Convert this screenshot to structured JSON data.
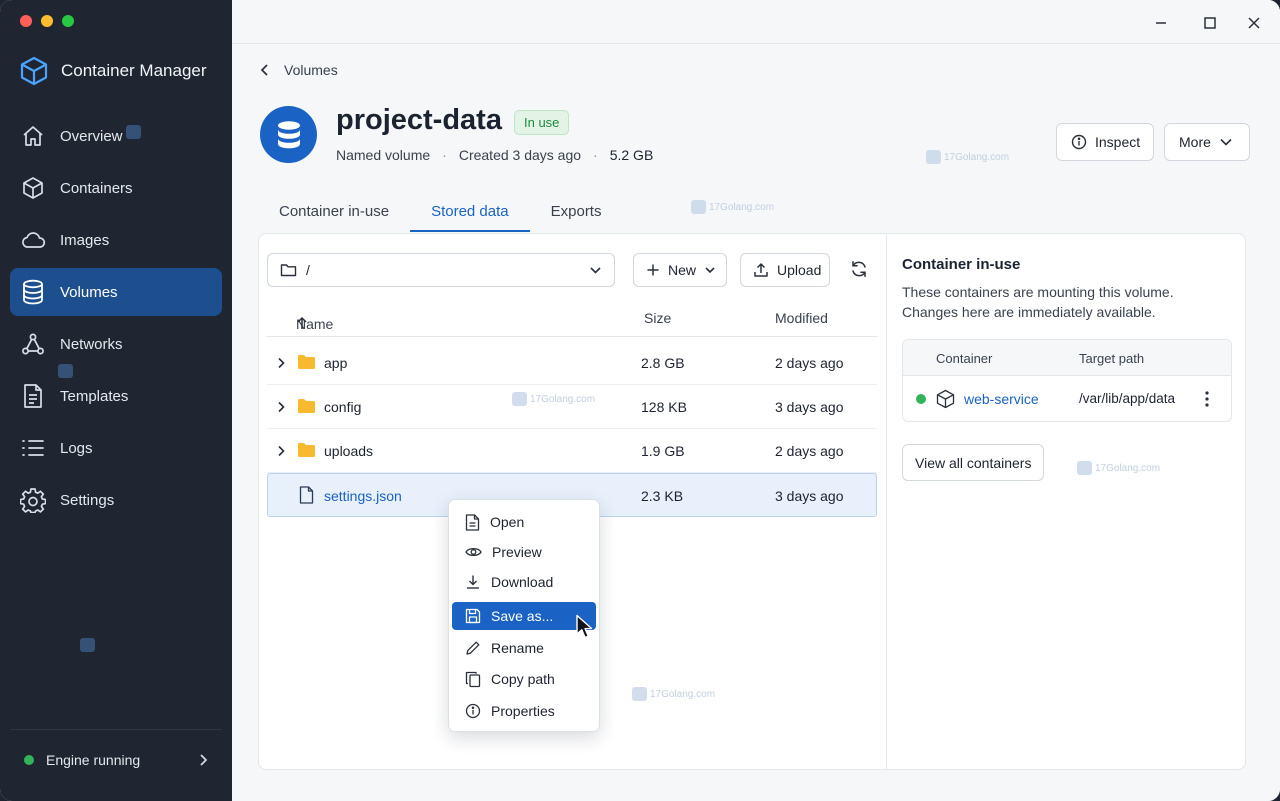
{
  "app": {
    "name": "Container Manager",
    "accent": "#1a62c4"
  },
  "sidebar": {
    "items": [
      {
        "label": "Overview",
        "icon": "home-icon"
      },
      {
        "label": "Containers",
        "icon": "cube-icon"
      },
      {
        "label": "Images",
        "icon": "cloud-icon"
      },
      {
        "label": "Volumes",
        "icon": "database-icon",
        "active": true
      },
      {
        "label": "Networks",
        "icon": "network-icon"
      },
      {
        "label": "Templates",
        "icon": "document-icon"
      },
      {
        "label": "Logs",
        "icon": "list-icon"
      },
      {
        "label": "Settings",
        "icon": "gear-icon"
      }
    ],
    "engine_status": "Engine running"
  },
  "breadcrumb": {
    "back_label": "Volumes"
  },
  "volume": {
    "name": "project-data",
    "status": "In use",
    "type": "Named volume",
    "created": "Created 3 days ago",
    "size": "5.2 GB"
  },
  "actions": {
    "inspect": "Inspect",
    "more": "More"
  },
  "tabs": [
    {
      "label": "Container in-use"
    },
    {
      "label": "Stored data",
      "active": true
    },
    {
      "label": "Exports"
    }
  ],
  "browser": {
    "path": "/",
    "new_label": "New",
    "upload_label": "Upload",
    "columns": {
      "name": "Name",
      "size": "Size",
      "modified": "Modified"
    },
    "rows": [
      {
        "name": "app",
        "type": "folder",
        "size": "2.8 GB",
        "modified": "2 days ago"
      },
      {
        "name": "config",
        "type": "folder",
        "size": "128 KB",
        "modified": "3 days ago"
      },
      {
        "name": "uploads",
        "type": "folder",
        "size": "1.9 GB",
        "modified": "2 days ago"
      },
      {
        "name": "settings.json",
        "type": "file",
        "size": "2.3 KB",
        "modified": "3 days ago",
        "selected": true
      }
    ]
  },
  "context_menu": {
    "items": [
      {
        "label": "Open",
        "icon": "file-icon"
      },
      {
        "label": "Preview",
        "icon": "eye-icon"
      },
      {
        "label": "Download",
        "icon": "download-icon"
      },
      {
        "label": "Save as...",
        "icon": "save-icon",
        "active": true
      },
      {
        "label": "Rename",
        "icon": "pencil-icon"
      },
      {
        "label": "Copy path",
        "icon": "copy-icon"
      },
      {
        "label": "Properties",
        "icon": "info-icon"
      }
    ]
  },
  "panel": {
    "title": "Container in-use",
    "description": "These containers are mounting this volume. Changes here are immediately available.",
    "columns": {
      "container": "Container",
      "target": "Target path"
    },
    "rows": [
      {
        "container": "web-service",
        "target": "/var/lib/app/data",
        "status_color": "#33b35a"
      }
    ],
    "view_all": "View all containers"
  },
  "watermark": "17Golang.com"
}
